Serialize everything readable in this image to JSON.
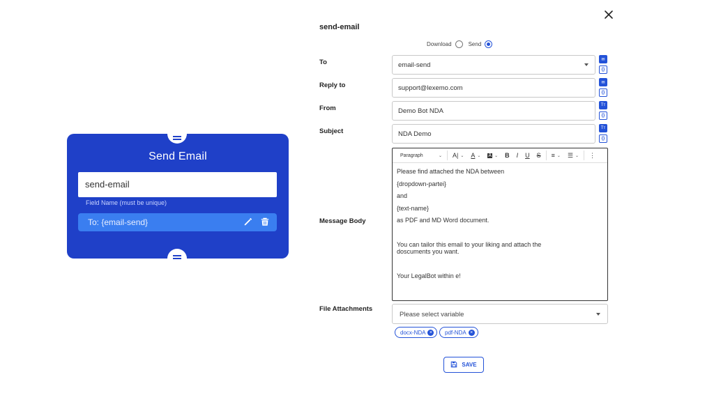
{
  "node": {
    "title": "Send Email",
    "name_value": "send-email",
    "hint": "Field Name (must be unique)",
    "field_label": "To: {email-send}",
    "edit_icon": "pencil-icon",
    "delete_icon": "trash-icon"
  },
  "form": {
    "title": "send-email",
    "mode": {
      "download_label": "Download",
      "send_label": "Send",
      "selected": "Send"
    },
    "to": {
      "label": "To",
      "value": "email-send"
    },
    "reply_to": {
      "label": "Reply to",
      "value": "support@lexemo.com"
    },
    "from": {
      "label": "From",
      "value": "Demo Bot NDA"
    },
    "subject": {
      "label": "Subject",
      "value": "NDA Demo"
    },
    "message_body": {
      "label": "Message Body",
      "toolbar": {
        "paragraph": "Paragraph"
      },
      "lines": [
        "Please find attached the NDA between",
        "{dropdown-partei}",
        " and",
        "{text-name}",
        "as PDF and MD Word document.",
        "",
        "You can tailor this email to your liking and attach the",
        "doscuments you want.",
        "",
        "Your LegalBot within e!"
      ]
    },
    "file_attachments": {
      "label": "File Attachments",
      "placeholder": "Please select variable",
      "chips": [
        "docx-NDA",
        "pdf-NDA"
      ]
    },
    "save_label": "SAVE"
  },
  "colors": {
    "accent": "#2352d8",
    "node_bg": "#1f40c8",
    "node_field": "#3a7ef0"
  }
}
